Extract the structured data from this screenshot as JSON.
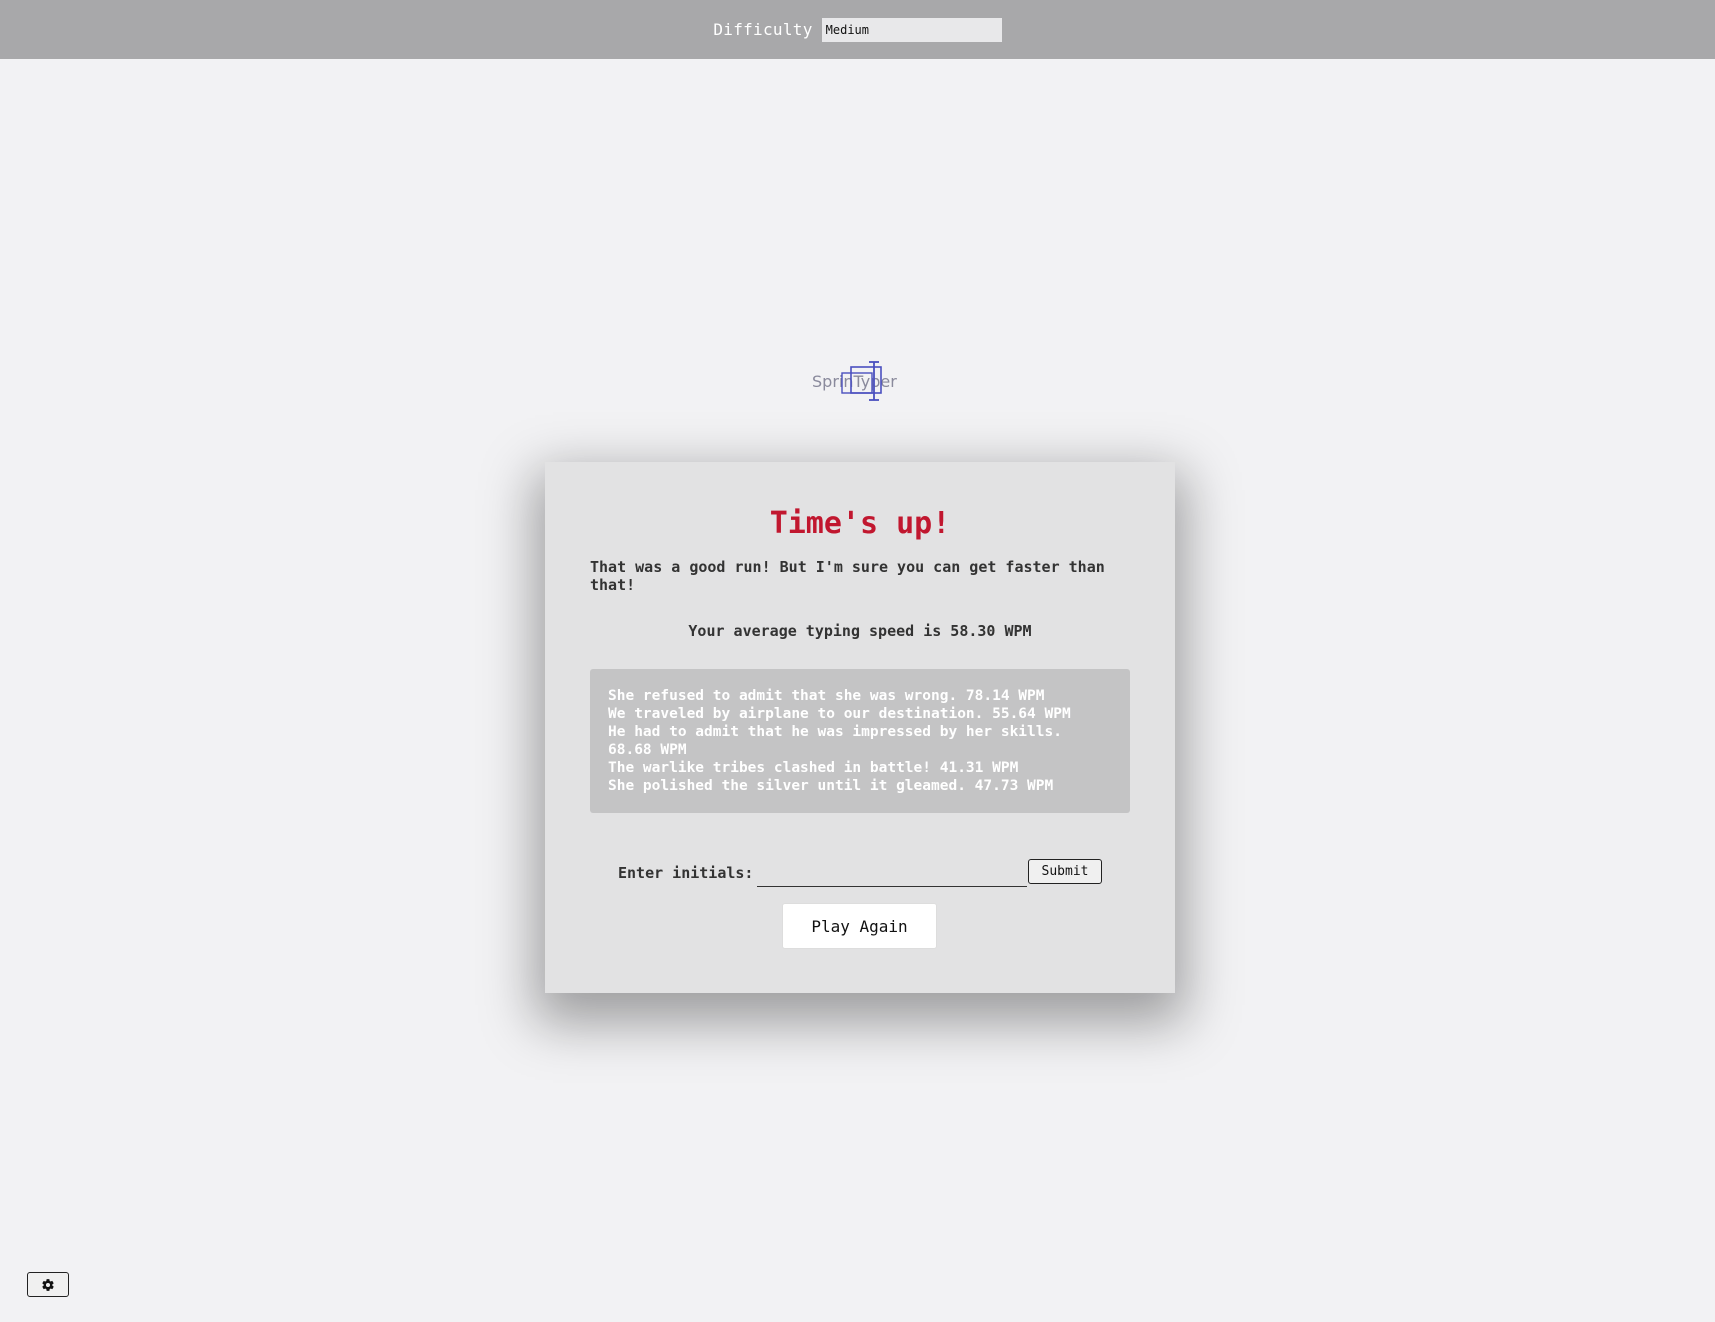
{
  "header": {
    "difficulty_label": "Difficulty",
    "difficulty_value": "Medium"
  },
  "logo": {
    "text": "SprinTyper"
  },
  "modal": {
    "title": "Time's up!",
    "message": "That was a good run! But I'm sure you can get faster than that!",
    "average": "Your average typing speed is 58.30 WPM",
    "results": [
      "She refused to admit that she was wrong. 78.14 WPM",
      "We traveled by airplane to our destination. 55.64 WPM",
      "He had to admit that he was impressed by her skills. 68.68 WPM",
      "The warlike tribes clashed in battle! 41.31 WPM",
      "She polished the silver until it gleamed. 47.73 WPM"
    ],
    "initials_label": "Enter initials:",
    "initials_value": "",
    "submit_label": "Submit",
    "play_again_label": "Play Again"
  },
  "footer": {
    "settings_icon": "gear-icon"
  },
  "colors": {
    "title": "#c1172f",
    "topbar": "#a8a8aa",
    "background": "#f2f2f4",
    "modal": "#e2e2e3",
    "results_box": "#c4c4c5",
    "logo_accent": "#4a4fbf"
  }
}
